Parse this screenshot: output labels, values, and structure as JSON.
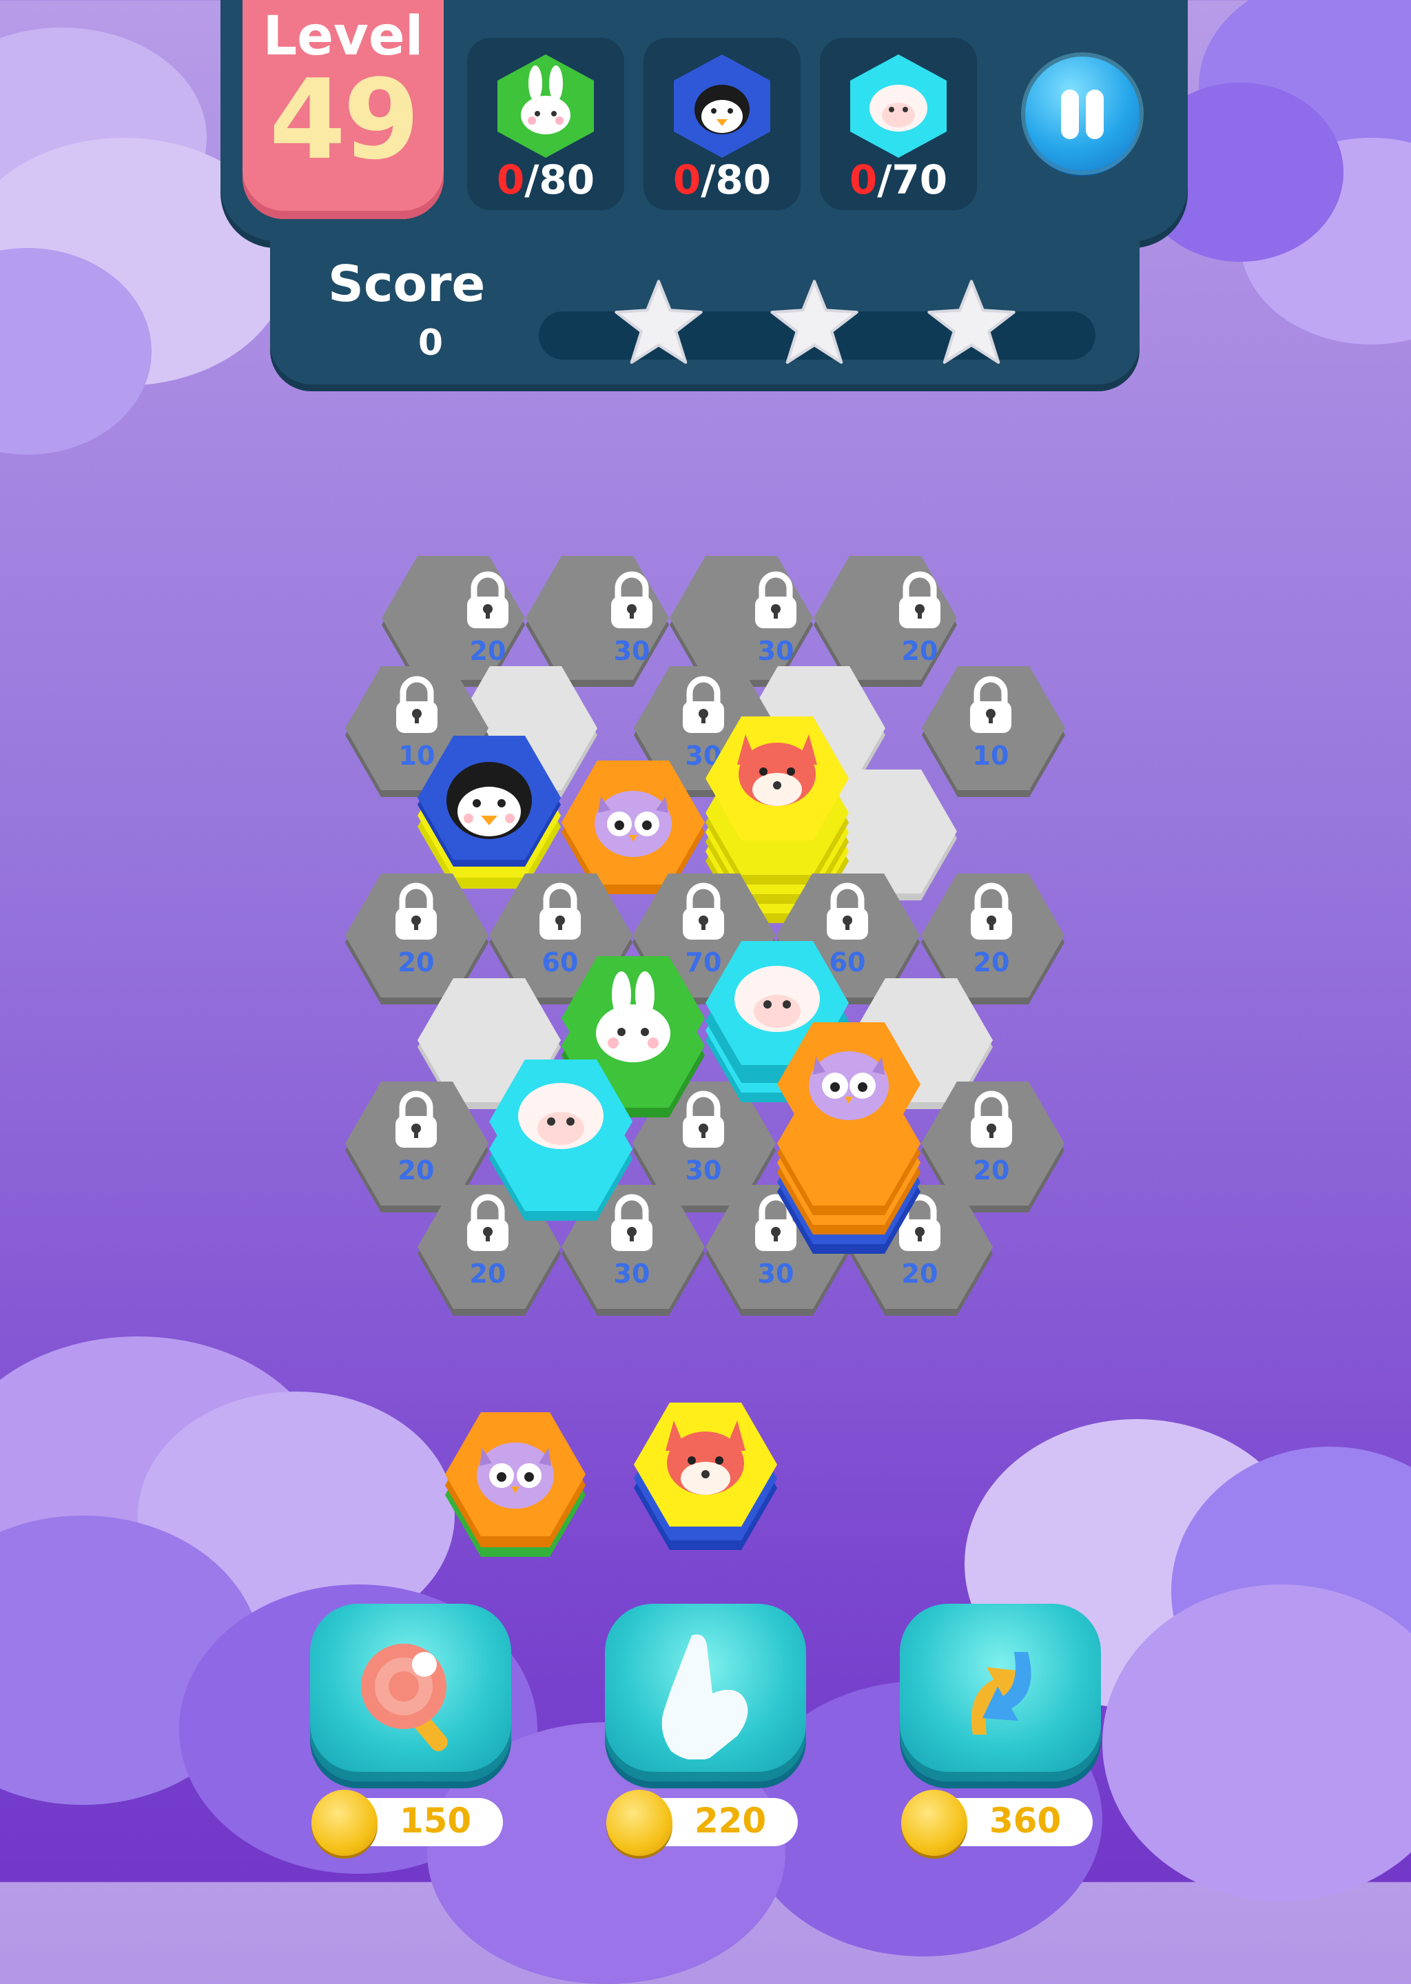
{
  "level": {
    "label": "Level",
    "number": "49"
  },
  "goals": [
    {
      "animal": "bunny-icon",
      "color": "#3ec33a",
      "current": "0",
      "target": "/80"
    },
    {
      "animal": "penguin-icon",
      "color": "#2f58d8",
      "current": "0",
      "target": "/80"
    },
    {
      "animal": "sheep-icon",
      "color": "#2fe0f0",
      "current": "0",
      "target": "/70"
    }
  ],
  "score": {
    "label": "Score",
    "value": "0",
    "progress": 0.0
  },
  "board": {
    "locked_costs": [
      "20",
      "30",
      "30",
      "20",
      "10",
      "30",
      "10",
      "20",
      "60",
      "70",
      "60",
      "20",
      "20",
      "30",
      "20",
      "20",
      "30",
      "30",
      "20"
    ]
  },
  "tray": [
    {
      "animal": "owl-icon",
      "color": "#ff9a1a"
    },
    {
      "animal": "fox-icon",
      "color": "#ffee1a"
    }
  ],
  "boosters": [
    {
      "name": "hammer-icon",
      "cost": "150"
    },
    {
      "name": "hand-icon",
      "cost": "220"
    },
    {
      "name": "shuffle-icon",
      "cost": "360"
    }
  ]
}
